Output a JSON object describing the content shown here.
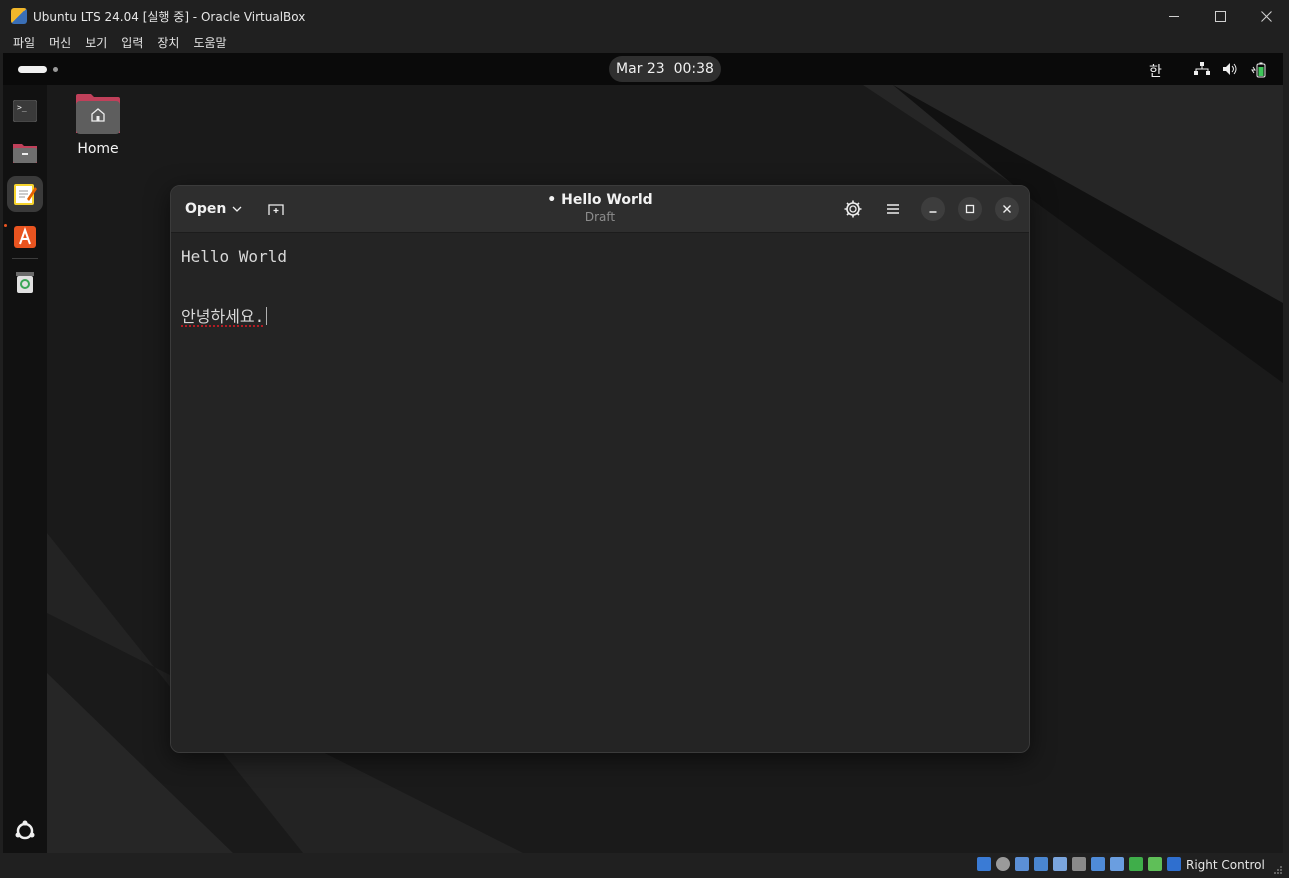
{
  "host": {
    "title": "Ubuntu LTS 24.04 [실행 중] - Oracle VirtualBox",
    "menu": [
      "파일",
      "머신",
      "보기",
      "입력",
      "장치",
      "도움말"
    ],
    "host_key": "Right Control"
  },
  "topbar": {
    "clock": "Mar 23  00:38",
    "input_method": "한"
  },
  "desktop": {
    "home_label": "Home"
  },
  "editor": {
    "open_label": "Open",
    "title": "• Hello World",
    "subtitle": "Draft",
    "lines": [
      "Hello World",
      "",
      "안녕하세요."
    ]
  },
  "colors": {
    "accent": "#e95420",
    "spell_error": "#e01b24",
    "folder": "#c0405a"
  }
}
